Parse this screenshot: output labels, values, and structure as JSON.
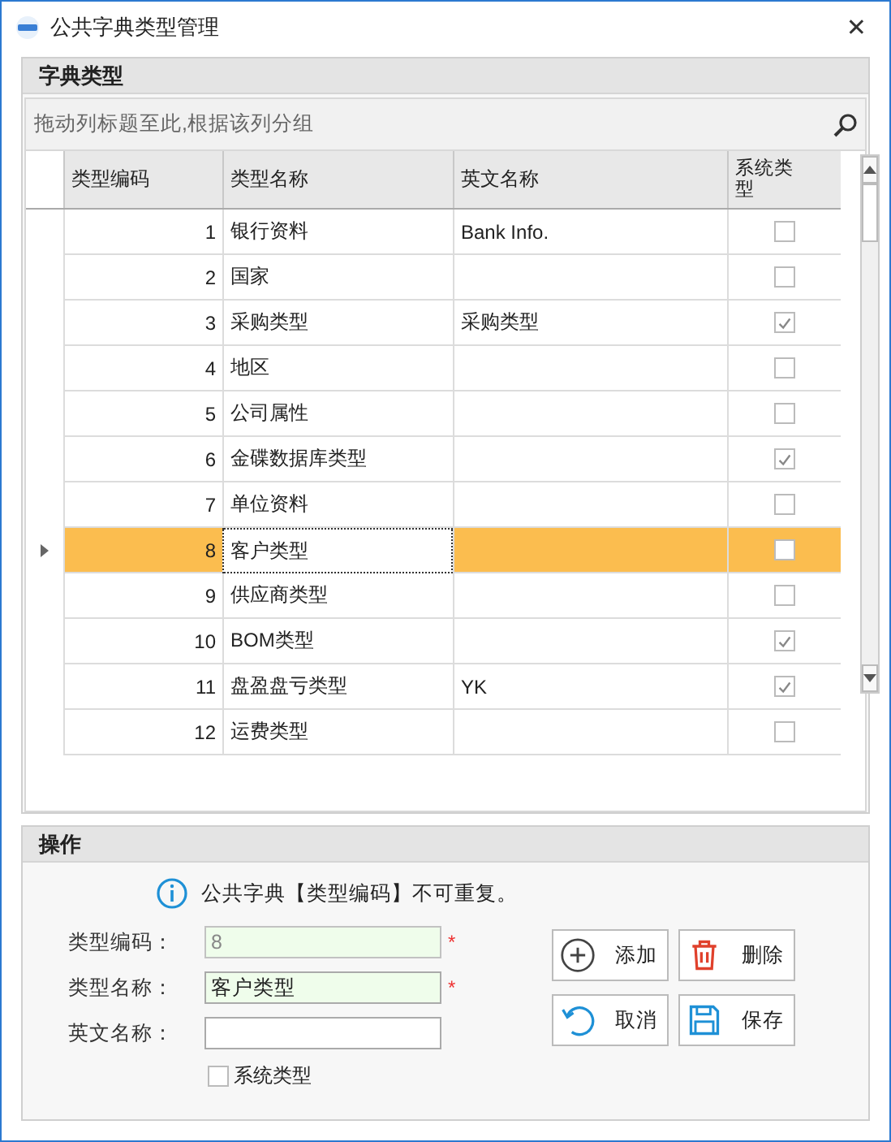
{
  "window": {
    "title": "公共字典类型管理",
    "close": "✕"
  },
  "dictionary_panel": {
    "title": "字典类型",
    "group_hint": "拖动列标题至此,根据该列分组",
    "columns": [
      "类型编码",
      "类型名称",
      "英文名称",
      "系统类型"
    ],
    "rows": [
      {
        "code": "1",
        "name": "银行资料",
        "english": "Bank Info.",
        "system": false,
        "selected": false
      },
      {
        "code": "2",
        "name": "国家",
        "english": "",
        "system": false,
        "selected": false
      },
      {
        "code": "3",
        "name": "采购类型",
        "english": "采购类型",
        "system": true,
        "selected": false
      },
      {
        "code": "4",
        "name": "地区",
        "english": "",
        "system": false,
        "selected": false
      },
      {
        "code": "5",
        "name": "公司属性",
        "english": "",
        "system": false,
        "selected": false
      },
      {
        "code": "6",
        "name": "金碟数据库类型",
        "english": "",
        "system": true,
        "selected": false
      },
      {
        "code": "7",
        "name": "单位资料",
        "english": "",
        "system": false,
        "selected": false
      },
      {
        "code": "8",
        "name": "客户类型",
        "english": "",
        "system": false,
        "selected": true
      },
      {
        "code": "9",
        "name": "供应商类型",
        "english": "",
        "system": false,
        "selected": false
      },
      {
        "code": "10",
        "name": "BOM类型",
        "english": "",
        "system": true,
        "selected": false
      },
      {
        "code": "11",
        "name": "盘盈盘亏类型",
        "english": "YK",
        "system": true,
        "selected": false
      },
      {
        "code": "12",
        "name": "运费类型",
        "english": "",
        "system": false,
        "selected": false
      }
    ]
  },
  "operation_panel": {
    "title": "操作",
    "notice": "公共字典【类型编码】不可重复。",
    "fields": [
      {
        "label": "类型编码：",
        "value": "8",
        "marker": "*",
        "readonly": true
      },
      {
        "label": "类型名称：",
        "value": "客户类型",
        "marker": "*",
        "readonly": false
      },
      {
        "label": "英文名称：",
        "readonly": false
      }
    ],
    "system_checkbox": {
      "label": "系统类型",
      "checked": false
    },
    "buttons": [
      {
        "label": "添加",
        "kind": "add"
      },
      {
        "label": "删除",
        "kind": "delete"
      },
      {
        "label": "取消",
        "kind": "cancel"
      },
      {
        "label": "保存",
        "kind": "save"
      }
    ]
  }
}
